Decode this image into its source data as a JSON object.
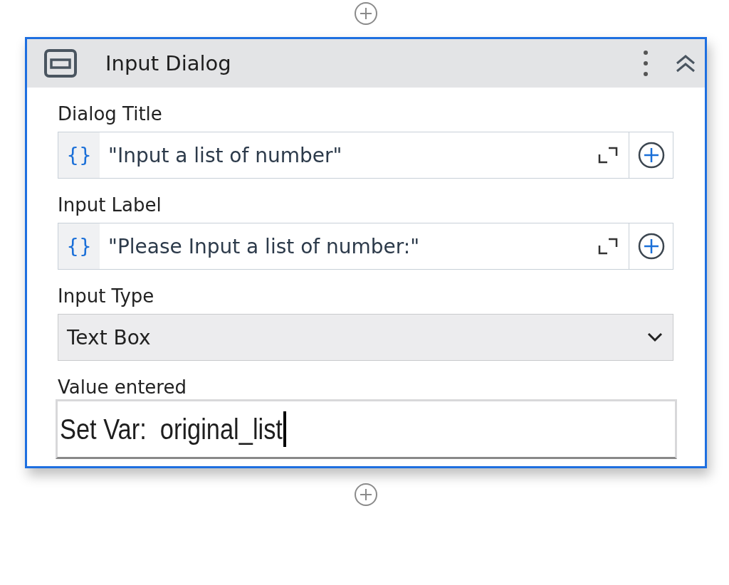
{
  "card": {
    "title": "Input Dialog"
  },
  "fields": [
    {
      "kind": "expression",
      "label": "Dialog Title",
      "prefix": "{}",
      "value": "\"Input a list of number\""
    },
    {
      "kind": "expression",
      "label": "Input Label",
      "prefix": "{}",
      "value": "\"Please Input a list of number:\""
    },
    {
      "kind": "dropdown",
      "label": "Input Type",
      "value": "Text Box"
    },
    {
      "kind": "text",
      "label": "Value entered",
      "value": "Set Var:  original_list"
    }
  ]
}
